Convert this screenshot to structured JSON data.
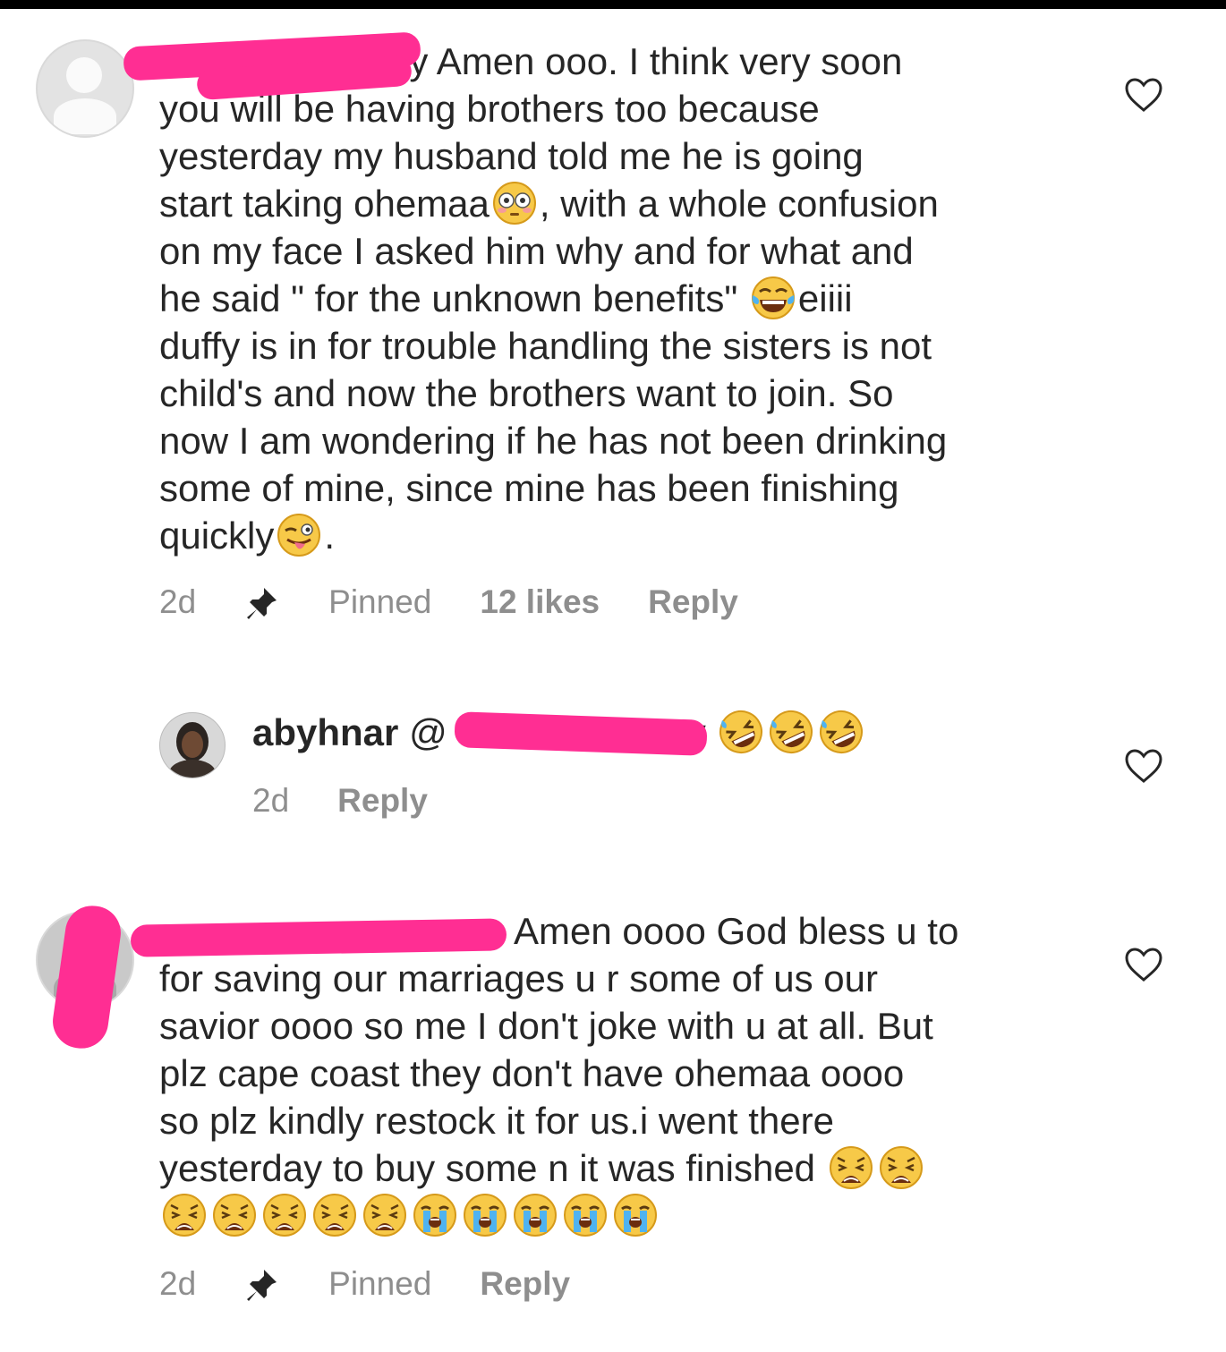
{
  "comments": [
    {
      "username_visible_fragment": "ly",
      "lines": [
        "Amen ooo. I think very soon",
        "you will be having brothers too because",
        "yesterday my husband told me he is going",
        "start taking ohemaa",
        ", with a whole confusion",
        "on my face I asked him why and for what and",
        "he said \" for the  unknown benefits\"",
        "eiiii",
        "duffy is in for trouble handling the sisters is not",
        "child's and now the brothers want to join. So",
        "now I am wondering if he has not been drinking",
        "some of mine, since mine has been finishing",
        "quickly",
        "."
      ],
      "time": "2d",
      "pinned_label": "Pinned",
      "likes": "12 likes",
      "reply_label": "Reply"
    },
    {
      "username": "abyhnar",
      "mention_visible": "@",
      "mention_tail": "y",
      "time": "2d",
      "reply_label": "Reply"
    },
    {
      "lines": [
        "Amen oooo God bless u to",
        "for saving our marriages u r some of us our",
        "savior oooo so me I don't joke with u at all. But",
        "plz cape coast they don't have ohemaa oooo",
        "so plz kindly restock it for us.i went there",
        "yesterday to buy some n it was finished"
      ],
      "time": "2d",
      "pinned_label": "Pinned",
      "reply_label": "Reply"
    }
  ],
  "icons": {
    "heart": "heart-outline-icon",
    "pin": "pin-icon",
    "emoji_flushed": "flushed-face-emoji",
    "emoji_tears_of_joy": "tears-of-joy-emoji",
    "emoji_tongue": "winking-tongue-emoji",
    "emoji_rofl": "rolling-on-floor-laughing-emoji",
    "emoji_weary": "weary-face-emoji",
    "emoji_crying": "loudly-crying-emoji"
  },
  "colors": {
    "text": "#262626",
    "meta": "#8e8e8e",
    "redaction": "#ff2e93"
  }
}
